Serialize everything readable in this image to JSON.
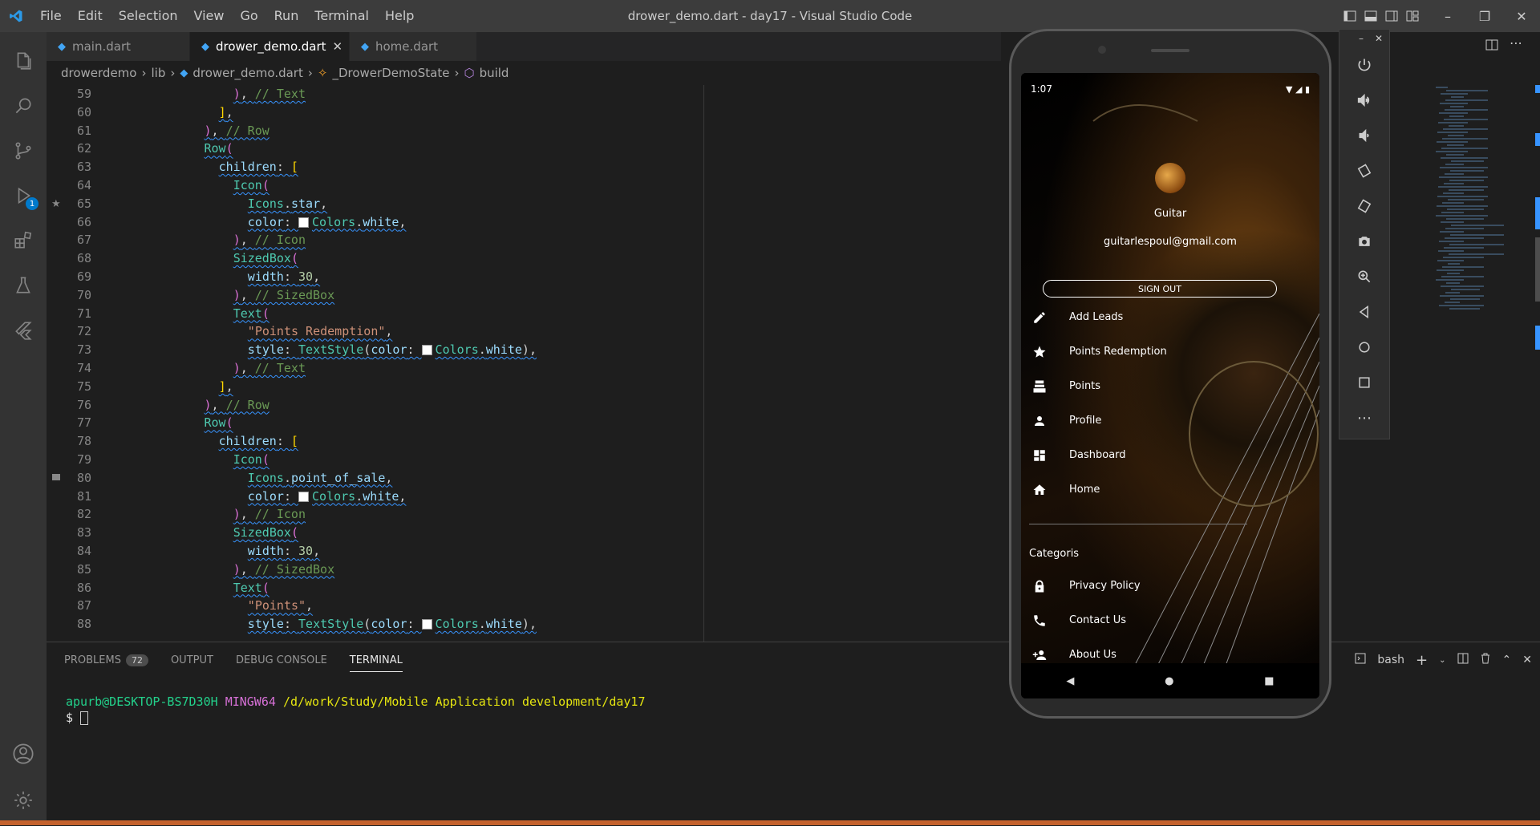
{
  "window": {
    "title": "drower_demo.dart - day17 - Visual Studio Code",
    "menu": [
      "File",
      "Edit",
      "Selection",
      "View",
      "Go",
      "Run",
      "Terminal",
      "Help"
    ]
  },
  "activity": {
    "debug_badge": "1"
  },
  "tabs": [
    {
      "label": "main.dart",
      "active": false
    },
    {
      "label": "drower_demo.dart",
      "active": true
    },
    {
      "label": "home.dart",
      "active": false
    }
  ],
  "breadcrumb": [
    "drowerdemo",
    "lib",
    "drower_demo.dart",
    "_DrowerDemoState",
    "build"
  ],
  "editor": {
    "lines": [
      {
        "n": "59",
        "html": "<span class=\"k-br\">)</span>, <span class=\"k-cm\">// Text</span>",
        "indent": 14
      },
      {
        "n": "60",
        "html": "<span class=\"k-br2\">]</span>,",
        "indent": 12
      },
      {
        "n": "61",
        "html": "<span class=\"k-br\">)</span>, <span class=\"k-cm\">// Row</span>",
        "indent": 10
      },
      {
        "n": "62",
        "html": "<span class=\"k-cls\">Row</span><span class=\"k-br\">(</span>",
        "indent": 10
      },
      {
        "n": "63",
        "html": "<span class=\"k-prop\">children</span>: <span class=\"k-br2\">[</span>",
        "indent": 12
      },
      {
        "n": "64",
        "html": "<span class=\"k-cls\">Icon</span><span class=\"k-br\">(</span>",
        "indent": 14
      },
      {
        "n": "65",
        "html": "<span class=\"k-cls\">Icons</span>.<span class=\"k-prop\">star</span>,",
        "indent": 16
      },
      {
        "n": "66",
        "html": "<span class=\"k-prop\">color</span>: <span class=\"swatch\"></span><span class=\"k-cls\">Colors</span>.<span class=\"k-prop\">white</span>,",
        "indent": 16
      },
      {
        "n": "67",
        "html": "<span class=\"k-br\">)</span>, <span class=\"k-cm\">// Icon</span>",
        "indent": 14
      },
      {
        "n": "68",
        "html": "<span class=\"k-cls\">SizedBox</span><span class=\"k-br\">(</span>",
        "indent": 14
      },
      {
        "n": "69",
        "html": "<span class=\"k-prop\">width</span>: <span class=\"k-num\">30</span>,",
        "indent": 16
      },
      {
        "n": "70",
        "html": "<span class=\"k-br\">)</span>, <span class=\"k-cm\">// SizedBox</span>",
        "indent": 14
      },
      {
        "n": "71",
        "html": "<span class=\"k-cls\">Text</span><span class=\"k-br\">(</span>",
        "indent": 14
      },
      {
        "n": "72",
        "html": "<span class=\"k-str\">\"Points Redemption\"</span>,",
        "indent": 16
      },
      {
        "n": "73",
        "html": "<span class=\"k-prop\">style</span>: <span class=\"k-cls\">TextStyle</span>(<span class=\"k-prop\">color</span>: <span class=\"swatch\"></span><span class=\"k-cls\">Colors</span>.<span class=\"k-prop\">white</span>),",
        "indent": 16
      },
      {
        "n": "74",
        "html": "<span class=\"k-br\">)</span>, <span class=\"k-cm\">// Text</span>",
        "indent": 14
      },
      {
        "n": "75",
        "html": "<span class=\"k-br2\">]</span>,",
        "indent": 12
      },
      {
        "n": "76",
        "html": "<span class=\"k-br\">)</span>, <span class=\"k-cm\">// Row</span>",
        "indent": 10
      },
      {
        "n": "77",
        "html": "<span class=\"k-cls\">Row</span><span class=\"k-br\">(</span>",
        "indent": 10
      },
      {
        "n": "78",
        "html": "<span class=\"k-prop\">children</span>: <span class=\"k-br2\">[</span>",
        "indent": 12
      },
      {
        "n": "79",
        "html": "<span class=\"k-cls\">Icon</span><span class=\"k-br\">(</span>",
        "indent": 14
      },
      {
        "n": "80",
        "html": "<span class=\"k-cls\">Icons</span>.<span class=\"k-prop\">point_of_sale</span>,",
        "indent": 16
      },
      {
        "n": "81",
        "html": "<span class=\"k-prop\">color</span>: <span class=\"swatch\"></span><span class=\"k-cls\">Colors</span>.<span class=\"k-prop\">white</span>,",
        "indent": 16
      },
      {
        "n": "82",
        "html": "<span class=\"k-br\">)</span>, <span class=\"k-cm\">// Icon</span>",
        "indent": 14
      },
      {
        "n": "83",
        "html": "<span class=\"k-cls\">SizedBox</span><span class=\"k-br\">(</span>",
        "indent": 14
      },
      {
        "n": "84",
        "html": "<span class=\"k-prop\">width</span>: <span class=\"k-num\">30</span>,",
        "indent": 16
      },
      {
        "n": "85",
        "html": "<span class=\"k-br\">)</span>, <span class=\"k-cm\">// SizedBox</span>",
        "indent": 14
      },
      {
        "n": "86",
        "html": "<span class=\"k-cls\">Text</span><span class=\"k-br\">(</span>",
        "indent": 14
      },
      {
        "n": "87",
        "html": "<span class=\"k-str\">\"Points\"</span>,",
        "indent": 16
      },
      {
        "n": "88",
        "html": "<span class=\"k-prop\">style</span>: <span class=\"k-cls\">TextStyle</span>(<span class=\"k-prop\">color</span>: <span class=\"swatch\"></span><span class=\"k-cls\">Colors</span>.<span class=\"k-prop\">white</span>),",
        "indent": 16
      }
    ]
  },
  "panel": {
    "tabs": [
      "PROBLEMS",
      "OUTPUT",
      "DEBUG CONSOLE",
      "TERMINAL"
    ],
    "problems_count": "72",
    "shell": "bash",
    "terminal_user": "apurb@DESKTOP-BS7D30H",
    "terminal_env": "MINGW64",
    "terminal_path": "/d/work/Study/Mobile Application development/day17",
    "prompt": "$"
  },
  "phone": {
    "time": "1:07",
    "drawer_name": "Guitar",
    "drawer_email": "guitarlespoul@gmail.com",
    "sign_out": "SIGN OUT",
    "items": [
      {
        "label": "Add Leads",
        "icon": "edit-icon"
      },
      {
        "label": "Points Redemption",
        "icon": "star-icon"
      },
      {
        "label": "Points",
        "icon": "point-of-sale-icon"
      },
      {
        "label": "Profile",
        "icon": "person-icon"
      },
      {
        "label": "Dashboard",
        "icon": "dashboard-icon"
      },
      {
        "label": "Home",
        "icon": "home-icon"
      }
    ],
    "category_title": "Categoris",
    "category_items": [
      {
        "label": "Privacy Policy",
        "icon": "lock-icon"
      },
      {
        "label": "Contact Us",
        "icon": "phone-icon"
      },
      {
        "label": "About Us",
        "icon": "person-add-icon"
      }
    ]
  },
  "colors": {
    "accent": "#007acc",
    "status_bar": "#c4622d",
    "terminal_user": "#23d18b",
    "terminal_env": "#d670d6",
    "terminal_path": "#e5e510"
  }
}
